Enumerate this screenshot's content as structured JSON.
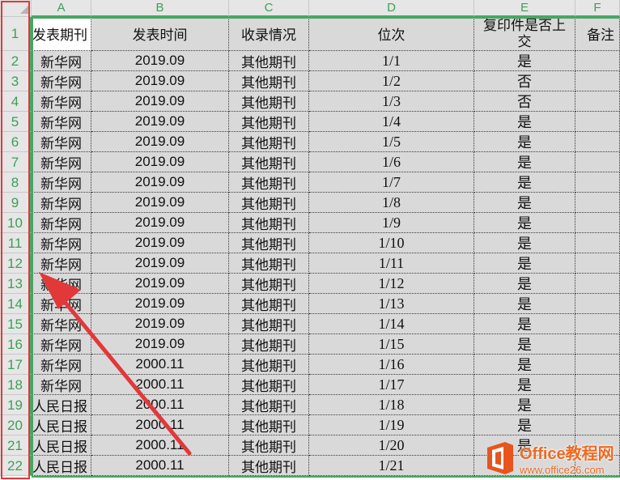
{
  "columns": [
    "A",
    "B",
    "C",
    "D",
    "E",
    "F"
  ],
  "column_widths": [
    74,
    170,
    99,
    204,
    125,
    55
  ],
  "rows": [
    {
      "n": "1",
      "cells": [
        "发表期刊",
        "发表时间",
        "收录情况",
        "位次",
        "复印件是否上交",
        "备注"
      ]
    },
    {
      "n": "2",
      "cells": [
        "新华网",
        "2019.09",
        "其他期刊",
        "1/1",
        "是",
        ""
      ]
    },
    {
      "n": "3",
      "cells": [
        "新华网",
        "2019.09",
        "其他期刊",
        "1/2",
        "否",
        ""
      ]
    },
    {
      "n": "4",
      "cells": [
        "新华网",
        "2019.09",
        "其他期刊",
        "1/3",
        "否",
        ""
      ]
    },
    {
      "n": "5",
      "cells": [
        "新华网",
        "2019.09",
        "其他期刊",
        "1/4",
        "是",
        ""
      ]
    },
    {
      "n": "6",
      "cells": [
        "新华网",
        "2019.09",
        "其他期刊",
        "1/5",
        "是",
        ""
      ]
    },
    {
      "n": "7",
      "cells": [
        "新华网",
        "2019.09",
        "其他期刊",
        "1/6",
        "是",
        ""
      ]
    },
    {
      "n": "8",
      "cells": [
        "新华网",
        "2019.09",
        "其他期刊",
        "1/7",
        "是",
        ""
      ]
    },
    {
      "n": "9",
      "cells": [
        "新华网",
        "2019.09",
        "其他期刊",
        "1/8",
        "是",
        ""
      ]
    },
    {
      "n": "10",
      "cells": [
        "新华网",
        "2019.09",
        "其他期刊",
        "1/9",
        "是",
        ""
      ]
    },
    {
      "n": "11",
      "cells": [
        "新华网",
        "2019.09",
        "其他期刊",
        "1/10",
        "是",
        ""
      ]
    },
    {
      "n": "12",
      "cells": [
        "新华网",
        "2019.09",
        "其他期刊",
        "1/11",
        "是",
        ""
      ]
    },
    {
      "n": "13",
      "cells": [
        "新华网",
        "2019.09",
        "其他期刊",
        "1/12",
        "是",
        ""
      ]
    },
    {
      "n": "14",
      "cells": [
        "新华网",
        "2019.09",
        "其他期刊",
        "1/13",
        "是",
        ""
      ]
    },
    {
      "n": "15",
      "cells": [
        "新华网",
        "2019.09",
        "其他期刊",
        "1/14",
        "是",
        ""
      ]
    },
    {
      "n": "16",
      "cells": [
        "新华网",
        "2019.09",
        "其他期刊",
        "1/15",
        "是",
        ""
      ]
    },
    {
      "n": "17",
      "cells": [
        "新华网",
        "2000.11",
        "其他期刊",
        "1/16",
        "是",
        ""
      ]
    },
    {
      "n": "18",
      "cells": [
        "新华网",
        "2000.11",
        "其他期刊",
        "1/17",
        "是",
        ""
      ]
    },
    {
      "n": "19",
      "cells": [
        "人民日报",
        "2000.11",
        "其他期刊",
        "1/18",
        "是",
        ""
      ]
    },
    {
      "n": "20",
      "cells": [
        "人民日报",
        "2000.11",
        "其他期刊",
        "1/19",
        "是",
        ""
      ]
    },
    {
      "n": "21",
      "cells": [
        "人民日报",
        "2000.11",
        "其他期刊",
        "1/20",
        "是",
        ""
      ]
    },
    {
      "n": "22",
      "cells": [
        "人民日报",
        "2000.11",
        "其他期刊",
        "1/21",
        "",
        ""
      ]
    }
  ],
  "watermark": {
    "brand": "Office教程网",
    "url": "www.office26.com"
  },
  "colors": {
    "header_green": "#3f9e58",
    "selection_green": "#4aa564",
    "highlight_red": "#e2383a",
    "watermark_orange": "#ee6a22"
  },
  "icons": {
    "annotation": "red-arrow-icon",
    "logo": "office-logo-icon"
  }
}
